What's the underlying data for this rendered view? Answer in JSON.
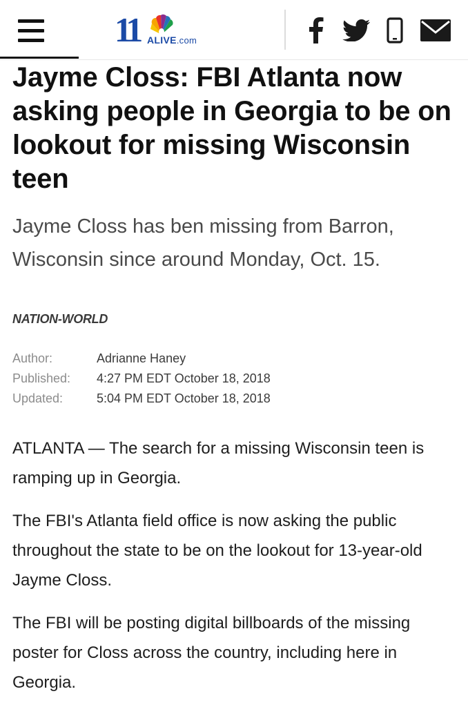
{
  "header": {
    "logo": {
      "number": "11",
      "brand": "ALIVE",
      "suffix": ".com"
    },
    "menu_icon": "hamburger-menu-icon",
    "social": [
      {
        "name": "facebook-icon"
      },
      {
        "name": "twitter-icon"
      },
      {
        "name": "mobile-icon"
      },
      {
        "name": "email-icon"
      }
    ]
  },
  "article": {
    "headline": "Jayme Closs: FBI Atlanta now asking people in Georgia to be on lookout for missing Wisconsin teen",
    "subhead": "Jayme Closs has ben missing from Barron, Wisconsin since around Monday, Oct. 15.",
    "section": "NATION-WORLD",
    "meta": {
      "author_label": "Author:",
      "author": "Adrianne Haney",
      "published_label": "Published:",
      "published": "4:27 PM EDT October 18, 2018",
      "updated_label": "Updated:",
      "updated": "5:04 PM EDT October 18, 2018"
    },
    "paragraphs": [
      "ATLANTA — The search for a missing Wisconsin teen is ramping up in Georgia.",
      "The FBI's Atlanta field office is now asking the public throughout the state to be on the lookout for 13-year-old Jayme Closs.",
      "The FBI will be posting digital billboards of the missing poster for Closs across the country, including here in Georgia."
    ]
  },
  "colors": {
    "brand_blue": "#1b4aa6",
    "text_dark": "#111111",
    "text_muted": "#8c8c8c"
  }
}
